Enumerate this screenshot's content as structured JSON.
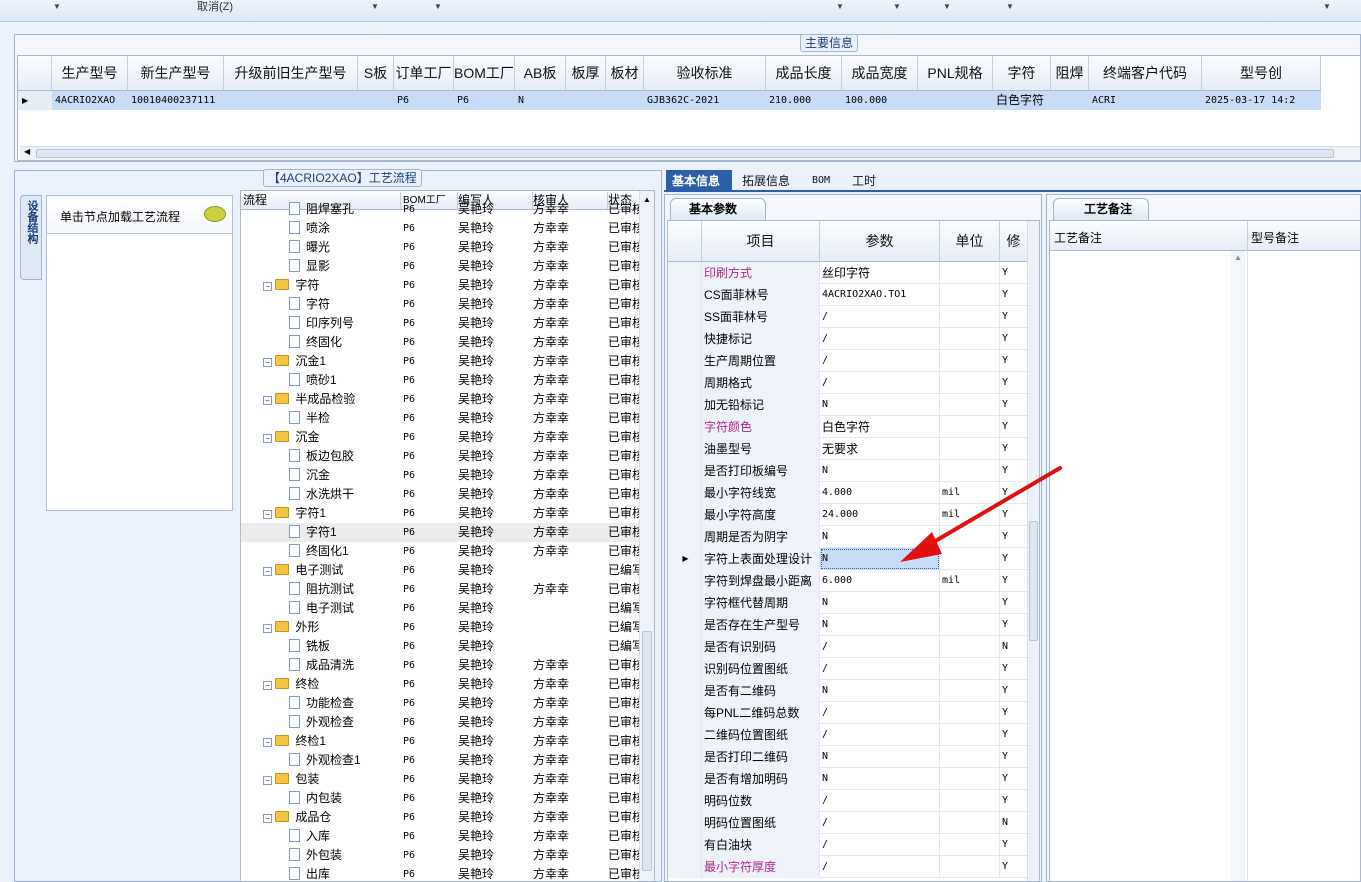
{
  "toolbar": {
    "cancel_label": "取消(Z)"
  },
  "main_info": {
    "caption": "主要信息",
    "columns": [
      "生产型号",
      "新生产型号",
      "升级前旧生产型号",
      "S板",
      "订单工厂",
      "BOM工厂",
      "AB板",
      "板厚",
      "板材",
      "验收标准",
      "成品长度",
      "成品宽度",
      "PNL规格",
      "字符",
      "阻焊",
      "终端客户代码",
      "型号创"
    ],
    "row": [
      "4ACRIO2XAO",
      "10010400237111",
      "",
      "",
      "P6",
      "P6",
      "N",
      "",
      "",
      "GJB362C-2021",
      "210.000",
      "100.000",
      "",
      "白色字符",
      "",
      "ACRI",
      "2025-03-17 14:2"
    ]
  },
  "left_panel": {
    "vertical_tab": "设备结构",
    "hint": "单击节点加载工艺流程"
  },
  "process": {
    "caption": "【4ACRIO2XAO】工艺流程",
    "columns": [
      "流程",
      "BOM工厂",
      "编写人",
      "核审人",
      "状态"
    ],
    "rows": [
      {
        "level": 2,
        "type": "doc",
        "name": "阻焊塞孔",
        "bom": "P6",
        "writer": "吴艳玲",
        "reviewer": "方幸幸",
        "status": "已审核"
      },
      {
        "level": 2,
        "type": "doc",
        "name": "喷涂",
        "bom": "P6",
        "writer": "吴艳玲",
        "reviewer": "方幸幸",
        "status": "已审核"
      },
      {
        "level": 2,
        "type": "doc",
        "name": "曝光",
        "bom": "P6",
        "writer": "吴艳玲",
        "reviewer": "方幸幸",
        "status": "已审核"
      },
      {
        "level": 2,
        "type": "doc",
        "name": "显影",
        "bom": "P6",
        "writer": "吴艳玲",
        "reviewer": "方幸幸",
        "status": "已审核"
      },
      {
        "level": 1,
        "type": "folder",
        "name": "字符",
        "bom": "P6",
        "writer": "吴艳玲",
        "reviewer": "方幸幸",
        "status": "已审核"
      },
      {
        "level": 2,
        "type": "doc",
        "name": "字符",
        "bom": "P6",
        "writer": "吴艳玲",
        "reviewer": "方幸幸",
        "status": "已审核"
      },
      {
        "level": 2,
        "type": "doc",
        "name": "印序列号",
        "bom": "P6",
        "writer": "吴艳玲",
        "reviewer": "方幸幸",
        "status": "已审核"
      },
      {
        "level": 2,
        "type": "doc",
        "name": "终固化",
        "bom": "P6",
        "writer": "吴艳玲",
        "reviewer": "方幸幸",
        "status": "已审核"
      },
      {
        "level": 1,
        "type": "folder",
        "name": "沉金1",
        "bom": "P6",
        "writer": "吴艳玲",
        "reviewer": "方幸幸",
        "status": "已审核"
      },
      {
        "level": 2,
        "type": "doc",
        "name": "喷砂1",
        "bom": "P6",
        "writer": "吴艳玲",
        "reviewer": "方幸幸",
        "status": "已审核"
      },
      {
        "level": 1,
        "type": "folder",
        "name": "半成品检验",
        "bom": "P6",
        "writer": "吴艳玲",
        "reviewer": "方幸幸",
        "status": "已审核"
      },
      {
        "level": 2,
        "type": "doc",
        "name": "半检",
        "bom": "P6",
        "writer": "吴艳玲",
        "reviewer": "方幸幸",
        "status": "已审核"
      },
      {
        "level": 1,
        "type": "folder",
        "name": "沉金",
        "bom": "P6",
        "writer": "吴艳玲",
        "reviewer": "方幸幸",
        "status": "已审核"
      },
      {
        "level": 2,
        "type": "doc",
        "name": "板边包胶",
        "bom": "P6",
        "writer": "吴艳玲",
        "reviewer": "方幸幸",
        "status": "已审核"
      },
      {
        "level": 2,
        "type": "doc",
        "name": "沉金",
        "bom": "P6",
        "writer": "吴艳玲",
        "reviewer": "方幸幸",
        "status": "已审核"
      },
      {
        "level": 2,
        "type": "doc",
        "name": "水洗烘干",
        "bom": "P6",
        "writer": "吴艳玲",
        "reviewer": "方幸幸",
        "status": "已审核"
      },
      {
        "level": 1,
        "type": "folder",
        "name": "字符1",
        "bom": "P6",
        "writer": "吴艳玲",
        "reviewer": "方幸幸",
        "status": "已审核"
      },
      {
        "level": 2,
        "type": "doc",
        "name": "字符1",
        "bom": "P6",
        "writer": "吴艳玲",
        "reviewer": "方幸幸",
        "status": "已审核",
        "selected": true
      },
      {
        "level": 2,
        "type": "doc",
        "name": "终固化1",
        "bom": "P6",
        "writer": "吴艳玲",
        "reviewer": "方幸幸",
        "status": "已审核"
      },
      {
        "level": 1,
        "type": "folder",
        "name": "电子测试",
        "bom": "P6",
        "writer": "吴艳玲",
        "reviewer": "",
        "status": "已编写"
      },
      {
        "level": 2,
        "type": "doc",
        "name": "阻抗测试",
        "bom": "P6",
        "writer": "吴艳玲",
        "reviewer": "方幸幸",
        "status": "已审核"
      },
      {
        "level": 2,
        "type": "doc",
        "name": "电子测试",
        "bom": "P6",
        "writer": "吴艳玲",
        "reviewer": "",
        "status": "已编写"
      },
      {
        "level": 1,
        "type": "folder",
        "name": "外形",
        "bom": "P6",
        "writer": "吴艳玲",
        "reviewer": "",
        "status": "已编写"
      },
      {
        "level": 2,
        "type": "doc",
        "name": "铣板",
        "bom": "P6",
        "writer": "吴艳玲",
        "reviewer": "",
        "status": "已编写"
      },
      {
        "level": 2,
        "type": "doc",
        "name": "成品清洗",
        "bom": "P6",
        "writer": "吴艳玲",
        "reviewer": "方幸幸",
        "status": "已审核"
      },
      {
        "level": 1,
        "type": "folder",
        "name": "终检",
        "bom": "P6",
        "writer": "吴艳玲",
        "reviewer": "方幸幸",
        "status": "已审核"
      },
      {
        "level": 2,
        "type": "doc",
        "name": "功能检查",
        "bom": "P6",
        "writer": "吴艳玲",
        "reviewer": "方幸幸",
        "status": "已审核"
      },
      {
        "level": 2,
        "type": "doc",
        "name": "外观检查",
        "bom": "P6",
        "writer": "吴艳玲",
        "reviewer": "方幸幸",
        "status": "已审核"
      },
      {
        "level": 1,
        "type": "folder",
        "name": "终检1",
        "bom": "P6",
        "writer": "吴艳玲",
        "reviewer": "方幸幸",
        "status": "已审核"
      },
      {
        "level": 2,
        "type": "doc",
        "name": "外观检查1",
        "bom": "P6",
        "writer": "吴艳玲",
        "reviewer": "方幸幸",
        "status": "已审核"
      },
      {
        "level": 1,
        "type": "folder",
        "name": "包装",
        "bom": "P6",
        "writer": "吴艳玲",
        "reviewer": "方幸幸",
        "status": "已审核"
      },
      {
        "level": 2,
        "type": "doc",
        "name": "内包装",
        "bom": "P6",
        "writer": "吴艳玲",
        "reviewer": "方幸幸",
        "status": "已审核"
      },
      {
        "level": 1,
        "type": "folder",
        "name": "成品仓",
        "bom": "P6",
        "writer": "吴艳玲",
        "reviewer": "方幸幸",
        "status": "已审核"
      },
      {
        "level": 2,
        "type": "doc",
        "name": "入库",
        "bom": "P6",
        "writer": "吴艳玲",
        "reviewer": "方幸幸",
        "status": "已审核"
      },
      {
        "level": 2,
        "type": "doc",
        "name": "外包装",
        "bom": "P6",
        "writer": "吴艳玲",
        "reviewer": "方幸幸",
        "status": "已审核"
      },
      {
        "level": 2,
        "type": "doc",
        "name": "出库",
        "bom": "P6",
        "writer": "吴艳玲",
        "reviewer": "方幸幸",
        "status": "已审核"
      }
    ]
  },
  "tabs": [
    "基本信息",
    "拓展信息",
    "BOM",
    "工时"
  ],
  "basic_params": {
    "caption": "基本参数",
    "columns": [
      "项目",
      "参数",
      "单位",
      "修"
    ],
    "rows": [
      {
        "item": "印刷方式",
        "value": "丝印字符",
        "unit": "",
        "mod": "Y",
        "pink": true
      },
      {
        "item": "CS面菲林号",
        "value": "4ACRIO2XAO.TO1",
        "unit": "",
        "mod": "Y"
      },
      {
        "item": "SS面菲林号",
        "value": "/",
        "unit": "",
        "mod": "Y"
      },
      {
        "item": "快捷标记",
        "value": "/",
        "unit": "",
        "mod": "Y"
      },
      {
        "item": "生产周期位置",
        "value": "/",
        "unit": "",
        "mod": "Y"
      },
      {
        "item": "周期格式",
        "value": "/",
        "unit": "",
        "mod": "Y"
      },
      {
        "item": "加无铅标记",
        "value": "N",
        "unit": "",
        "mod": "Y"
      },
      {
        "item": "字符颜色",
        "value": "白色字符",
        "unit": "",
        "mod": "Y",
        "pink": true
      },
      {
        "item": "油墨型号",
        "value": "无要求",
        "unit": "",
        "mod": "Y"
      },
      {
        "item": "是否打印板编号",
        "value": "N",
        "unit": "",
        "mod": "Y"
      },
      {
        "item": "最小字符线宽",
        "value": "4.000",
        "unit": "mil",
        "mod": "Y"
      },
      {
        "item": "最小字符高度",
        "value": "24.000",
        "unit": "mil",
        "mod": "Y"
      },
      {
        "item": "周期是否为阴字",
        "value": "N",
        "unit": "",
        "mod": "Y"
      },
      {
        "item": "字符上表面处理设计",
        "value": "N",
        "unit": "",
        "mod": "Y",
        "selected": true
      },
      {
        "item": "字符到焊盘最小距离",
        "value": "6.000",
        "unit": "mil",
        "mod": "Y"
      },
      {
        "item": "字符框代替周期",
        "value": "N",
        "unit": "",
        "mod": "Y"
      },
      {
        "item": "是否存在生产型号",
        "value": "N",
        "unit": "",
        "mod": "Y"
      },
      {
        "item": "是否有识别码",
        "value": "/",
        "unit": "",
        "mod": "N"
      },
      {
        "item": "识别码位置图纸",
        "value": "/",
        "unit": "",
        "mod": "Y"
      },
      {
        "item": "是否有二维码",
        "value": "N",
        "unit": "",
        "mod": "Y"
      },
      {
        "item": "每PNL二维码总数",
        "value": "/",
        "unit": "",
        "mod": "Y"
      },
      {
        "item": "二维码位置图纸",
        "value": "/",
        "unit": "",
        "mod": "Y"
      },
      {
        "item": "是否打印二维码",
        "value": "N",
        "unit": "",
        "mod": "Y"
      },
      {
        "item": "是否有增加明码",
        "value": "N",
        "unit": "",
        "mod": "Y"
      },
      {
        "item": "明码位数",
        "value": "/",
        "unit": "",
        "mod": "Y"
      },
      {
        "item": "明码位置图纸",
        "value": "/",
        "unit": "",
        "mod": "N"
      },
      {
        "item": "有白油块",
        "value": "/",
        "unit": "",
        "mod": "Y"
      },
      {
        "item": "最小字符厚度",
        "value": "/",
        "unit": "",
        "mod": "Y",
        "pink": true
      }
    ]
  },
  "process_notes": {
    "caption": "工艺备注",
    "columns": [
      "工艺备注",
      "型号备注"
    ]
  },
  "colors": {
    "accent": "#2d5fa8",
    "annotation": "#e01010",
    "pink": "#b0268c",
    "selection": "#c8dcf8"
  }
}
